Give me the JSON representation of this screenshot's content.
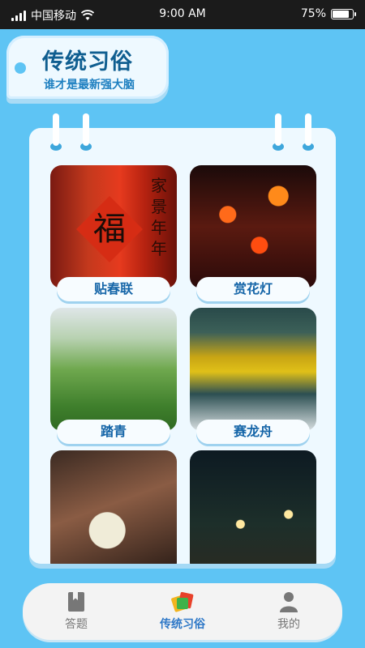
{
  "status_bar": {
    "carrier": "中国移动",
    "time": "9:00 AM",
    "battery_percent": "75%",
    "battery_level": 0.75
  },
  "header": {
    "title": "传统习俗",
    "subtitle": "谁才是最新强大脑"
  },
  "customs": [
    {
      "label": "贴春联",
      "image": "couplet-photo"
    },
    {
      "label": "赏花灯",
      "image": "lantern-photo"
    },
    {
      "label": "踏青",
      "image": "spring-outing-photo"
    },
    {
      "label": "赛龙舟",
      "image": "dragon-boat-photo"
    },
    {
      "label": "",
      "image": "embroidery-photo"
    },
    {
      "label": "",
      "image": "night-lanterns-photo"
    }
  ],
  "photo_text": {
    "fu": "福",
    "couplet": "家景年年"
  },
  "bottom_nav": {
    "tabs": [
      {
        "label": "答题",
        "icon": "book-icon",
        "active": false
      },
      {
        "label": "传统习俗",
        "icon": "customs-icon",
        "active": true
      },
      {
        "label": "我的",
        "icon": "user-icon",
        "active": false
      }
    ]
  },
  "colors": {
    "background": "#5ec4f4",
    "accent": "#2e78c7",
    "title": "#0f5e90"
  }
}
